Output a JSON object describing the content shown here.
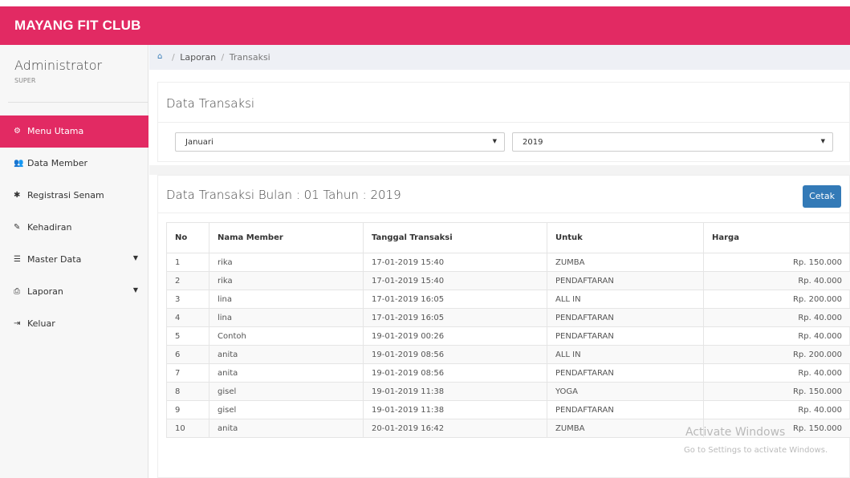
{
  "app": {
    "brand": "MAYANG FIT CLUB"
  },
  "user": {
    "name": "Administrator",
    "role": "SUPER"
  },
  "sidebar": {
    "items": [
      {
        "label": "Menu Utama",
        "icon": "dashboard-icon",
        "glyph": "⚙",
        "active": true
      },
      {
        "label": "Data Member",
        "icon": "users-icon",
        "glyph": "👥",
        "active": false
      },
      {
        "label": "Registrasi Senam",
        "icon": "gear-icon",
        "glyph": "✱",
        "active": false
      },
      {
        "label": "Kehadiran",
        "icon": "edit-icon",
        "glyph": "✎",
        "active": false
      },
      {
        "label": "Master Data",
        "icon": "database-icon",
        "glyph": "☰",
        "active": false,
        "caret": "▼"
      },
      {
        "label": "Laporan",
        "icon": "print-icon",
        "glyph": "⎙",
        "active": false,
        "caret": "▼"
      },
      {
        "label": "Keluar",
        "icon": "sign-out-icon",
        "glyph": "⇥",
        "active": false
      }
    ]
  },
  "breadcrumb": {
    "home_icon": "home-icon",
    "home_glyph": "⌂",
    "section": "Laporan",
    "current": "Transaksi"
  },
  "filter": {
    "title": "Data Transaksi",
    "month": "Januari",
    "year": "2019"
  },
  "report": {
    "title": "Data Transaksi Bulan : 01 Tahun : 2019",
    "print_label": "Cetak",
    "columns": [
      "No",
      "Nama Member",
      "Tanggal Transaksi",
      "Untuk",
      "Harga"
    ],
    "rows": [
      [
        "1",
        "rika",
        "17-01-2019 15:40",
        "ZUMBA",
        "Rp. 150.000"
      ],
      [
        "2",
        "rika",
        "17-01-2019 15:40",
        "PENDAFTARAN",
        "Rp. 40.000"
      ],
      [
        "3",
        "lina",
        "17-01-2019 16:05",
        "ALL IN",
        "Rp. 200.000"
      ],
      [
        "4",
        "lina",
        "17-01-2019 16:05",
        "PENDAFTARAN",
        "Rp. 40.000"
      ],
      [
        "5",
        "Contoh",
        "19-01-2019 00:26",
        "PENDAFTARAN",
        "Rp. 40.000"
      ],
      [
        "6",
        "anita",
        "19-01-2019 08:56",
        "ALL IN",
        "Rp. 200.000"
      ],
      [
        "7",
        "anita",
        "19-01-2019 08:56",
        "PENDAFTARAN",
        "Rp. 40.000"
      ],
      [
        "8",
        "gisel",
        "19-01-2019 11:38",
        "YOGA",
        "Rp. 150.000"
      ],
      [
        "9",
        "gisel",
        "19-01-2019 11:38",
        "PENDAFTARAN",
        "Rp. 40.000"
      ],
      [
        "10",
        "anita",
        "20-01-2019 16:42",
        "ZUMBA",
        "Rp. 150.000"
      ]
    ]
  },
  "watermark": {
    "line1": "Activate Windows",
    "line2": "Go to Settings to activate Windows."
  },
  "colors": {
    "brand": "#e22a63",
    "primary_button": "#337ab7"
  }
}
